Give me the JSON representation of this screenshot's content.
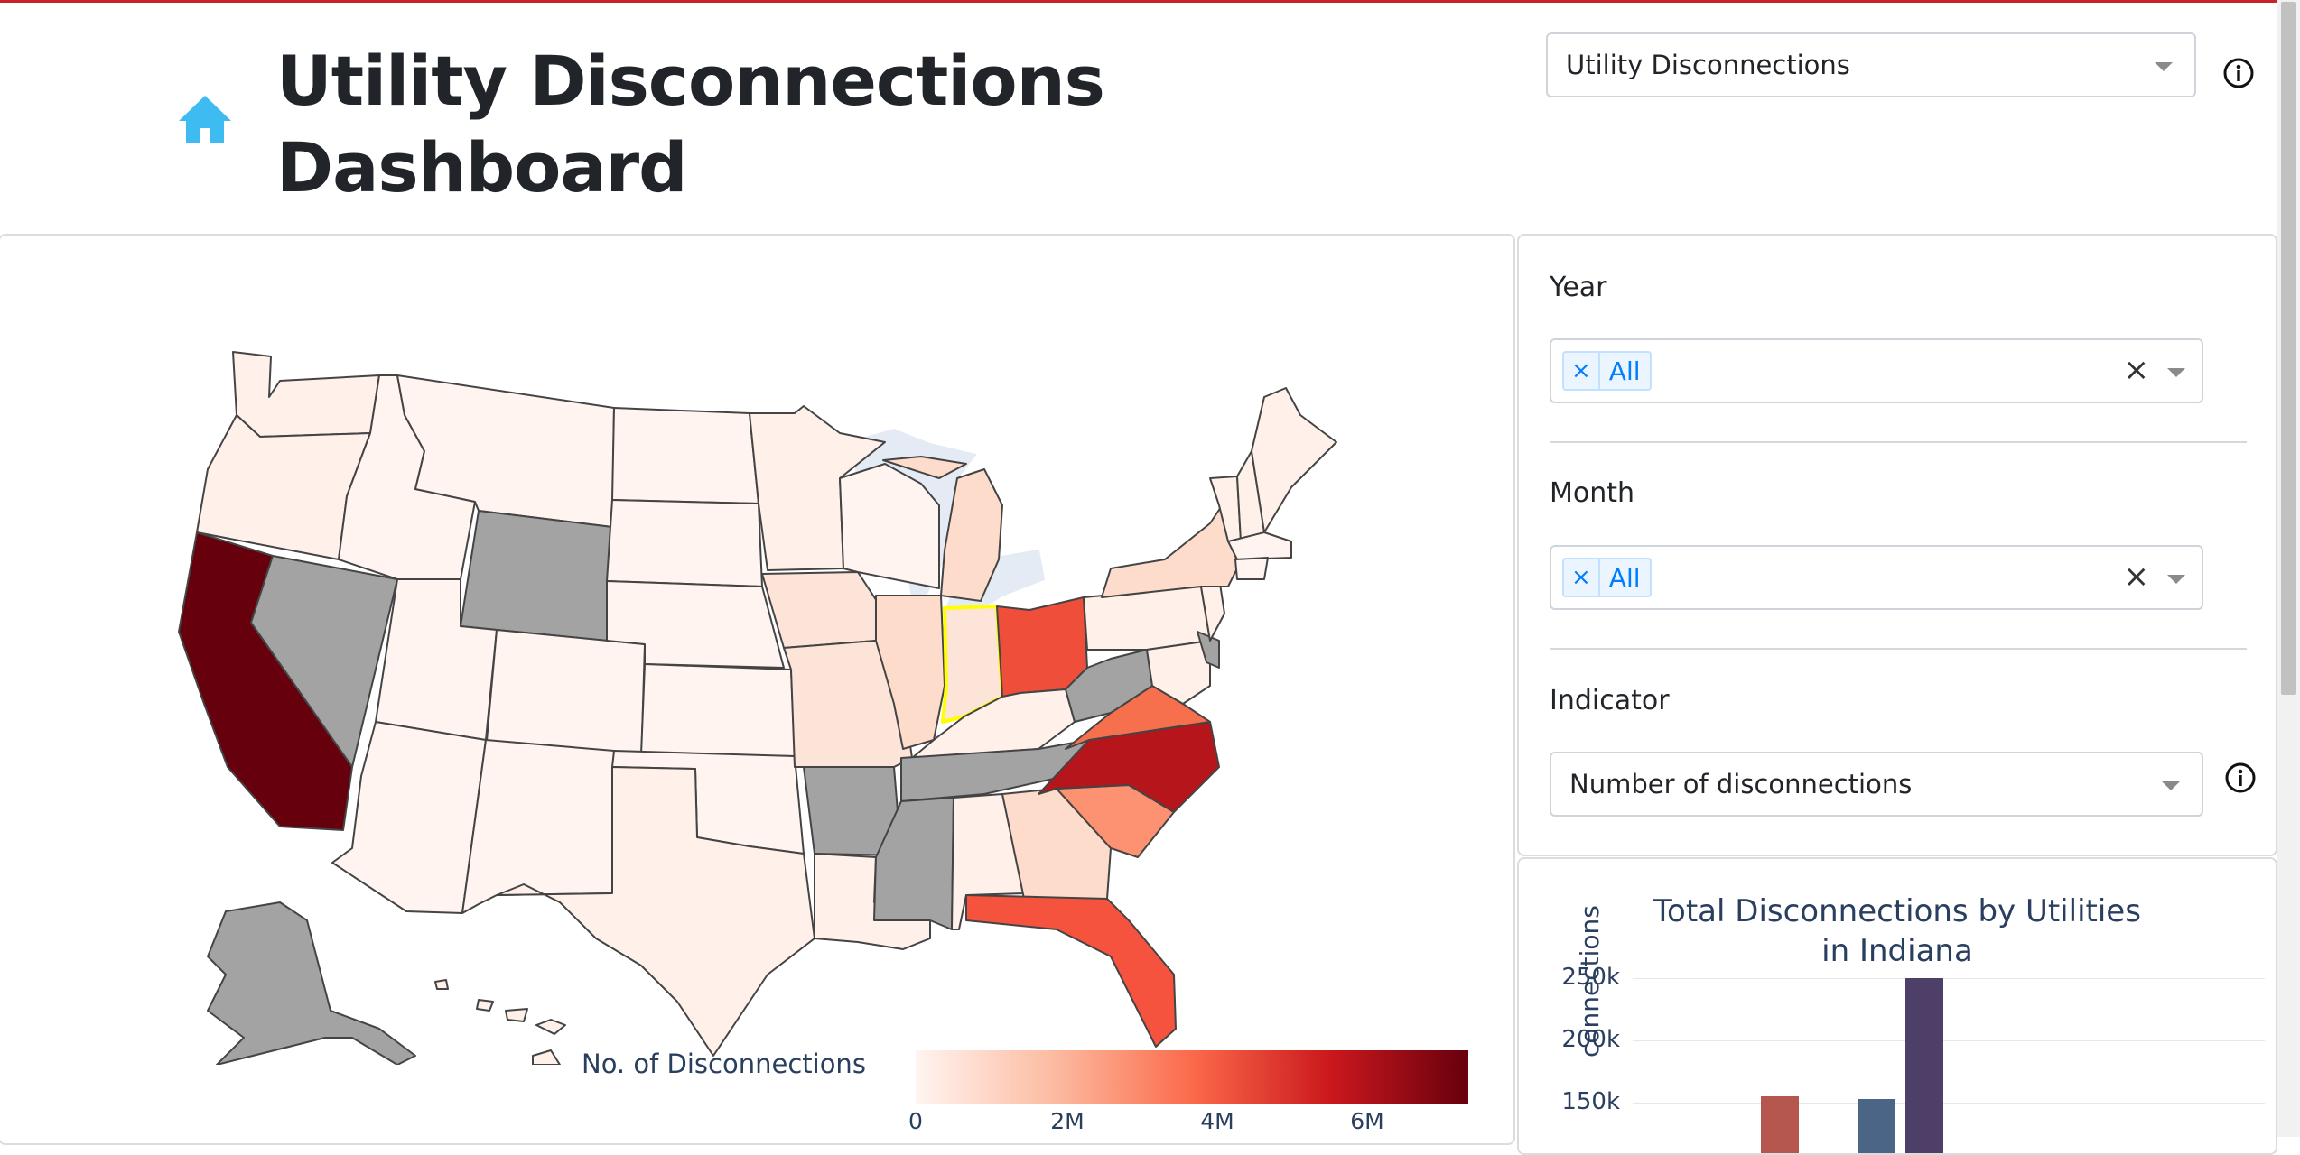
{
  "header": {
    "title_line1": "Utility Disconnections",
    "title_line2": "Dashboard",
    "dataset_select": "Utility Disconnections"
  },
  "filters": {
    "year_label": "Year",
    "year_tag": "All",
    "month_label": "Month",
    "month_tag": "All",
    "indicator_label": "Indicator",
    "indicator_value": "Number of disconnections",
    "tag_remove": "×",
    "clear": "×"
  },
  "map": {
    "legend_title": "No. of Disconnections",
    "ticks": [
      "0",
      "2M",
      "4M",
      "6M"
    ],
    "selected_state": "Indiana",
    "colors": {
      "low": "#fff5f0",
      "high": "#67000d",
      "no_data": "#a3a3a3",
      "highlight": "#ffff00"
    }
  },
  "chart_data": {
    "type": "bar",
    "title_line1": "Total Disconnections by Utilities",
    "title_line2": "in Indiana",
    "ylabel": "connections",
    "yticks": [
      "250k",
      "200k",
      "150k"
    ],
    "series": [
      {
        "values": [
          155000
        ],
        "color": "#b5574e"
      },
      {
        "values": [
          153000
        ],
        "color": "#4a6585"
      },
      {
        "values": [
          250000
        ],
        "color": "#4e3f69"
      }
    ]
  }
}
